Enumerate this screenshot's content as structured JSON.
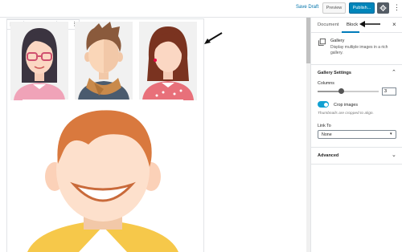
{
  "topbar": {
    "save_draft": "Save Draft",
    "preview": "Preview",
    "publish": "Publish...",
    "more_glyph": "⋮"
  },
  "block_toolbar": {
    "buttons": [
      {
        "icon": "gallery-icon",
        "glyph": "▣"
      },
      {
        "icon": "align-left-icon",
        "glyph": "⊫"
      },
      {
        "icon": "align-center-icon",
        "glyph": "⊞"
      },
      {
        "icon": "align-right-icon",
        "glyph": "⊪"
      },
      {
        "icon": "edit-pencil-icon",
        "glyph": "✎"
      },
      {
        "icon": "more-options-icon",
        "glyph": "⋮"
      }
    ]
  },
  "sidebar": {
    "tabs": [
      "Document",
      "Block"
    ],
    "active_tab": "Block",
    "close_glyph": "×",
    "block": {
      "name": "Gallery",
      "description": "Display multiple images in a rich gallery."
    },
    "gallery_settings": {
      "title": "Gallery Settings",
      "columns_label": "Columns",
      "columns_value": "3",
      "columns_slider_fraction": 0.39,
      "crop_label": "Crop images",
      "crop_enabled": true,
      "crop_help": "Thumbnails are cropped to align.",
      "link_to_label": "Link To",
      "link_to_value": "None"
    },
    "advanced": {
      "title": "Advanced"
    }
  },
  "colors": {
    "accent": "#0085ba",
    "toggle_on": "#11a0d2",
    "border": "#e2e4e7"
  }
}
